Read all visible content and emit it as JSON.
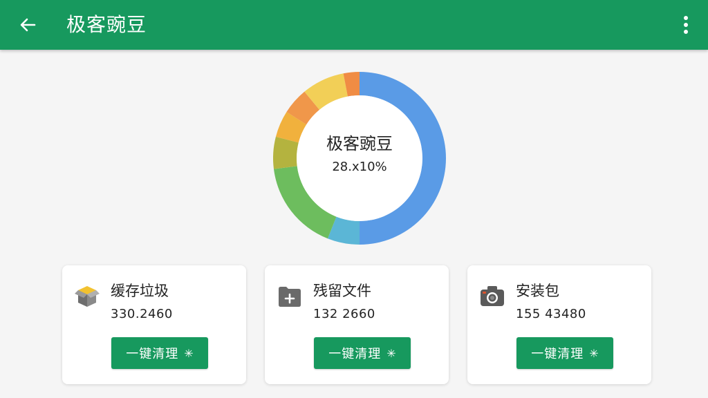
{
  "appbar": {
    "title": "极客豌豆",
    "back_icon": "arrow-left-icon",
    "more_icon": "more-vertical-icon"
  },
  "summary": {
    "title": "极客豌豆",
    "value": "28.x10%"
  },
  "chart_data": {
    "type": "pie",
    "donut": true,
    "slices": [
      {
        "value": 50,
        "color": "#5a9be6"
      },
      {
        "value": 6,
        "color": "#5bb6d6"
      },
      {
        "value": 17,
        "color": "#6dbd5e"
      },
      {
        "value": 6,
        "color": "#b4b33f"
      },
      {
        "value": 5,
        "color": "#f1b13d"
      },
      {
        "value": 5,
        "color": "#f0974a"
      },
      {
        "value": 8,
        "color": "#f2cf57"
      },
      {
        "value": 3,
        "color": "#f08c44"
      }
    ]
  },
  "cards": [
    {
      "title": "缓存垃圾",
      "size": "330.2460",
      "button_label": "一键清理",
      "icon": "open-box-icon",
      "button_icon": "sparkle-icon"
    },
    {
      "title": "残留文件",
      "size": "132 2660",
      "button_label": "一键清理",
      "icon": "folder-plus-icon",
      "button_icon": "sparkle-icon"
    },
    {
      "title": "安装包",
      "size": "155 43480",
      "button_label": "一键清理",
      "icon": "camera-icon",
      "button_icon": "sparkle-icon"
    }
  ],
  "colors": {
    "primary": "#17995e",
    "background": "#f5f5f5",
    "card": "#ffffff",
    "text": "#222222"
  }
}
